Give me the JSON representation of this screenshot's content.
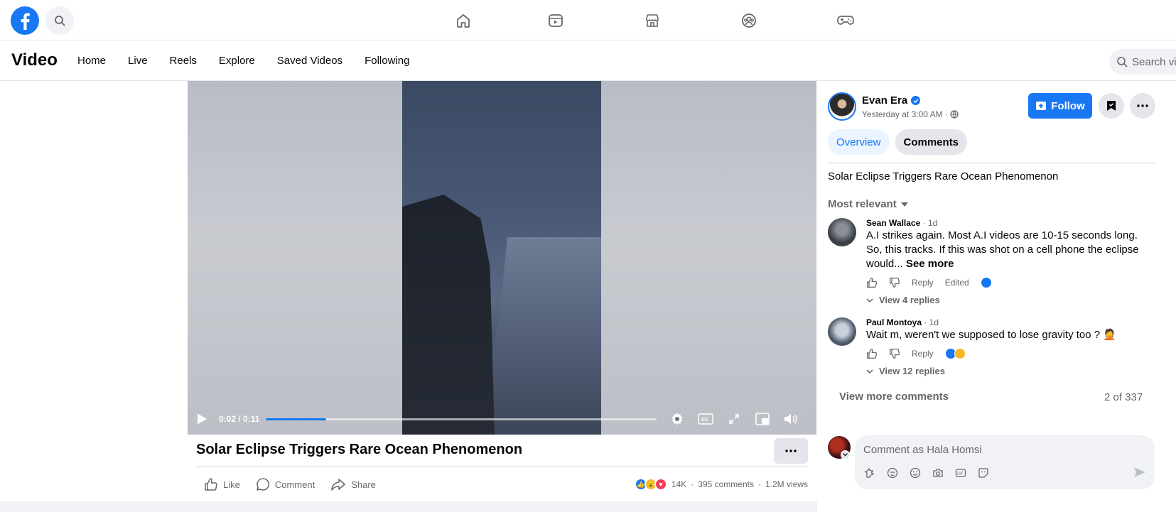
{
  "topbar": {
    "brand_color": "#1877f2",
    "nav_icons": [
      "home-icon",
      "video-icon",
      "marketplace-icon",
      "groups-icon",
      "gaming-icon"
    ]
  },
  "subbar": {
    "title": "Video",
    "nav": [
      "Home",
      "Live",
      "Reels",
      "Explore",
      "Saved Videos",
      "Following"
    ],
    "search_placeholder": "Search vid"
  },
  "player": {
    "time": "0:02 / 0:11",
    "progress": 0.155
  },
  "post": {
    "title": "Solar Eclipse Triggers Rare Ocean Phenomenon",
    "actions": {
      "like": "Like",
      "comment": "Comment",
      "share": "Share"
    },
    "reaction_count": "14K",
    "comments_count": "395 comments",
    "views": "1.2M views",
    "stats_separator": "·"
  },
  "panel": {
    "author": "Evan Era",
    "posted": "Yesterday at 3:00 AM ·",
    "follow_label": "Follow",
    "tabs": {
      "overview": "Overview",
      "comments": "Comments"
    },
    "caption": "Solar Eclipse Triggers Rare Ocean Phenomenon",
    "sort": "Most relevant",
    "comments": [
      {
        "name": "Sean Wallace",
        "ago": " · 1d",
        "text": "A.I strikes again. Most A.I videos are 10-15 seconds long. So, this tracks. If this was shot on a cell phone the eclipse would... ",
        "see_more": "See more",
        "reply": "Reply",
        "edited": "Edited",
        "replies": "View 4 replies"
      },
      {
        "name": "Paul Montoya",
        "ago": " · 1d",
        "text": "Wait m, weren't we supposed to lose gravity too ? 🤦",
        "reply": "Reply",
        "replies": "View 12 replies"
      }
    ],
    "view_more": "View more comments",
    "page_count": "2 of 337",
    "composer_placeholder": "Comment as Hala Homsi"
  }
}
